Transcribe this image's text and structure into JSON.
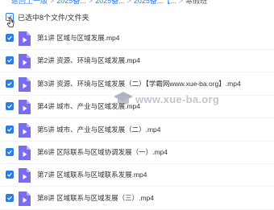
{
  "breadcrumb": {
    "items": [
      "返回上一级",
      "2025备...",
      "2025备...",
      "2025备...【...",
      "寒假班"
    ],
    "separator": ">"
  },
  "selection": {
    "label": "已选中8个文件/文件夹"
  },
  "files": [
    {
      "name": "第1讲 区域与区域发展.mp4",
      "checked": true
    },
    {
      "name": "第2讲 资源、环境与区域发展.mp4",
      "checked": true
    },
    {
      "name": "第3讲 资源、环境与区域发展（二）【学霸网www.xue-ba.org】.mp4",
      "checked": true
    },
    {
      "name": "第4讲 城市、产业与区域发展.mp4",
      "checked": true
    },
    {
      "name": "第5讲 城市、产业与区域发展（二）.mp4",
      "checked": true
    },
    {
      "name": "第6讲 区际联系与区域协调发展（一）.mp4",
      "checked": true
    },
    {
      "name": "第7讲 区域联系与区域联系发展.mp4",
      "checked": true
    },
    {
      "name": "第8讲 区域联系与区域发展（三）.mp4",
      "checked": true
    }
  ],
  "watermark": {
    "text": "www.xue-ba.org"
  },
  "colors": {
    "accent": "#2b7de9",
    "checkbox_checked": "#2b7de9",
    "video_icon": "#7a6cf0"
  },
  "icons": {
    "file": "video-file-icon",
    "check": "checkmark-icon",
    "cursor": "mouse-pointer-icon"
  }
}
